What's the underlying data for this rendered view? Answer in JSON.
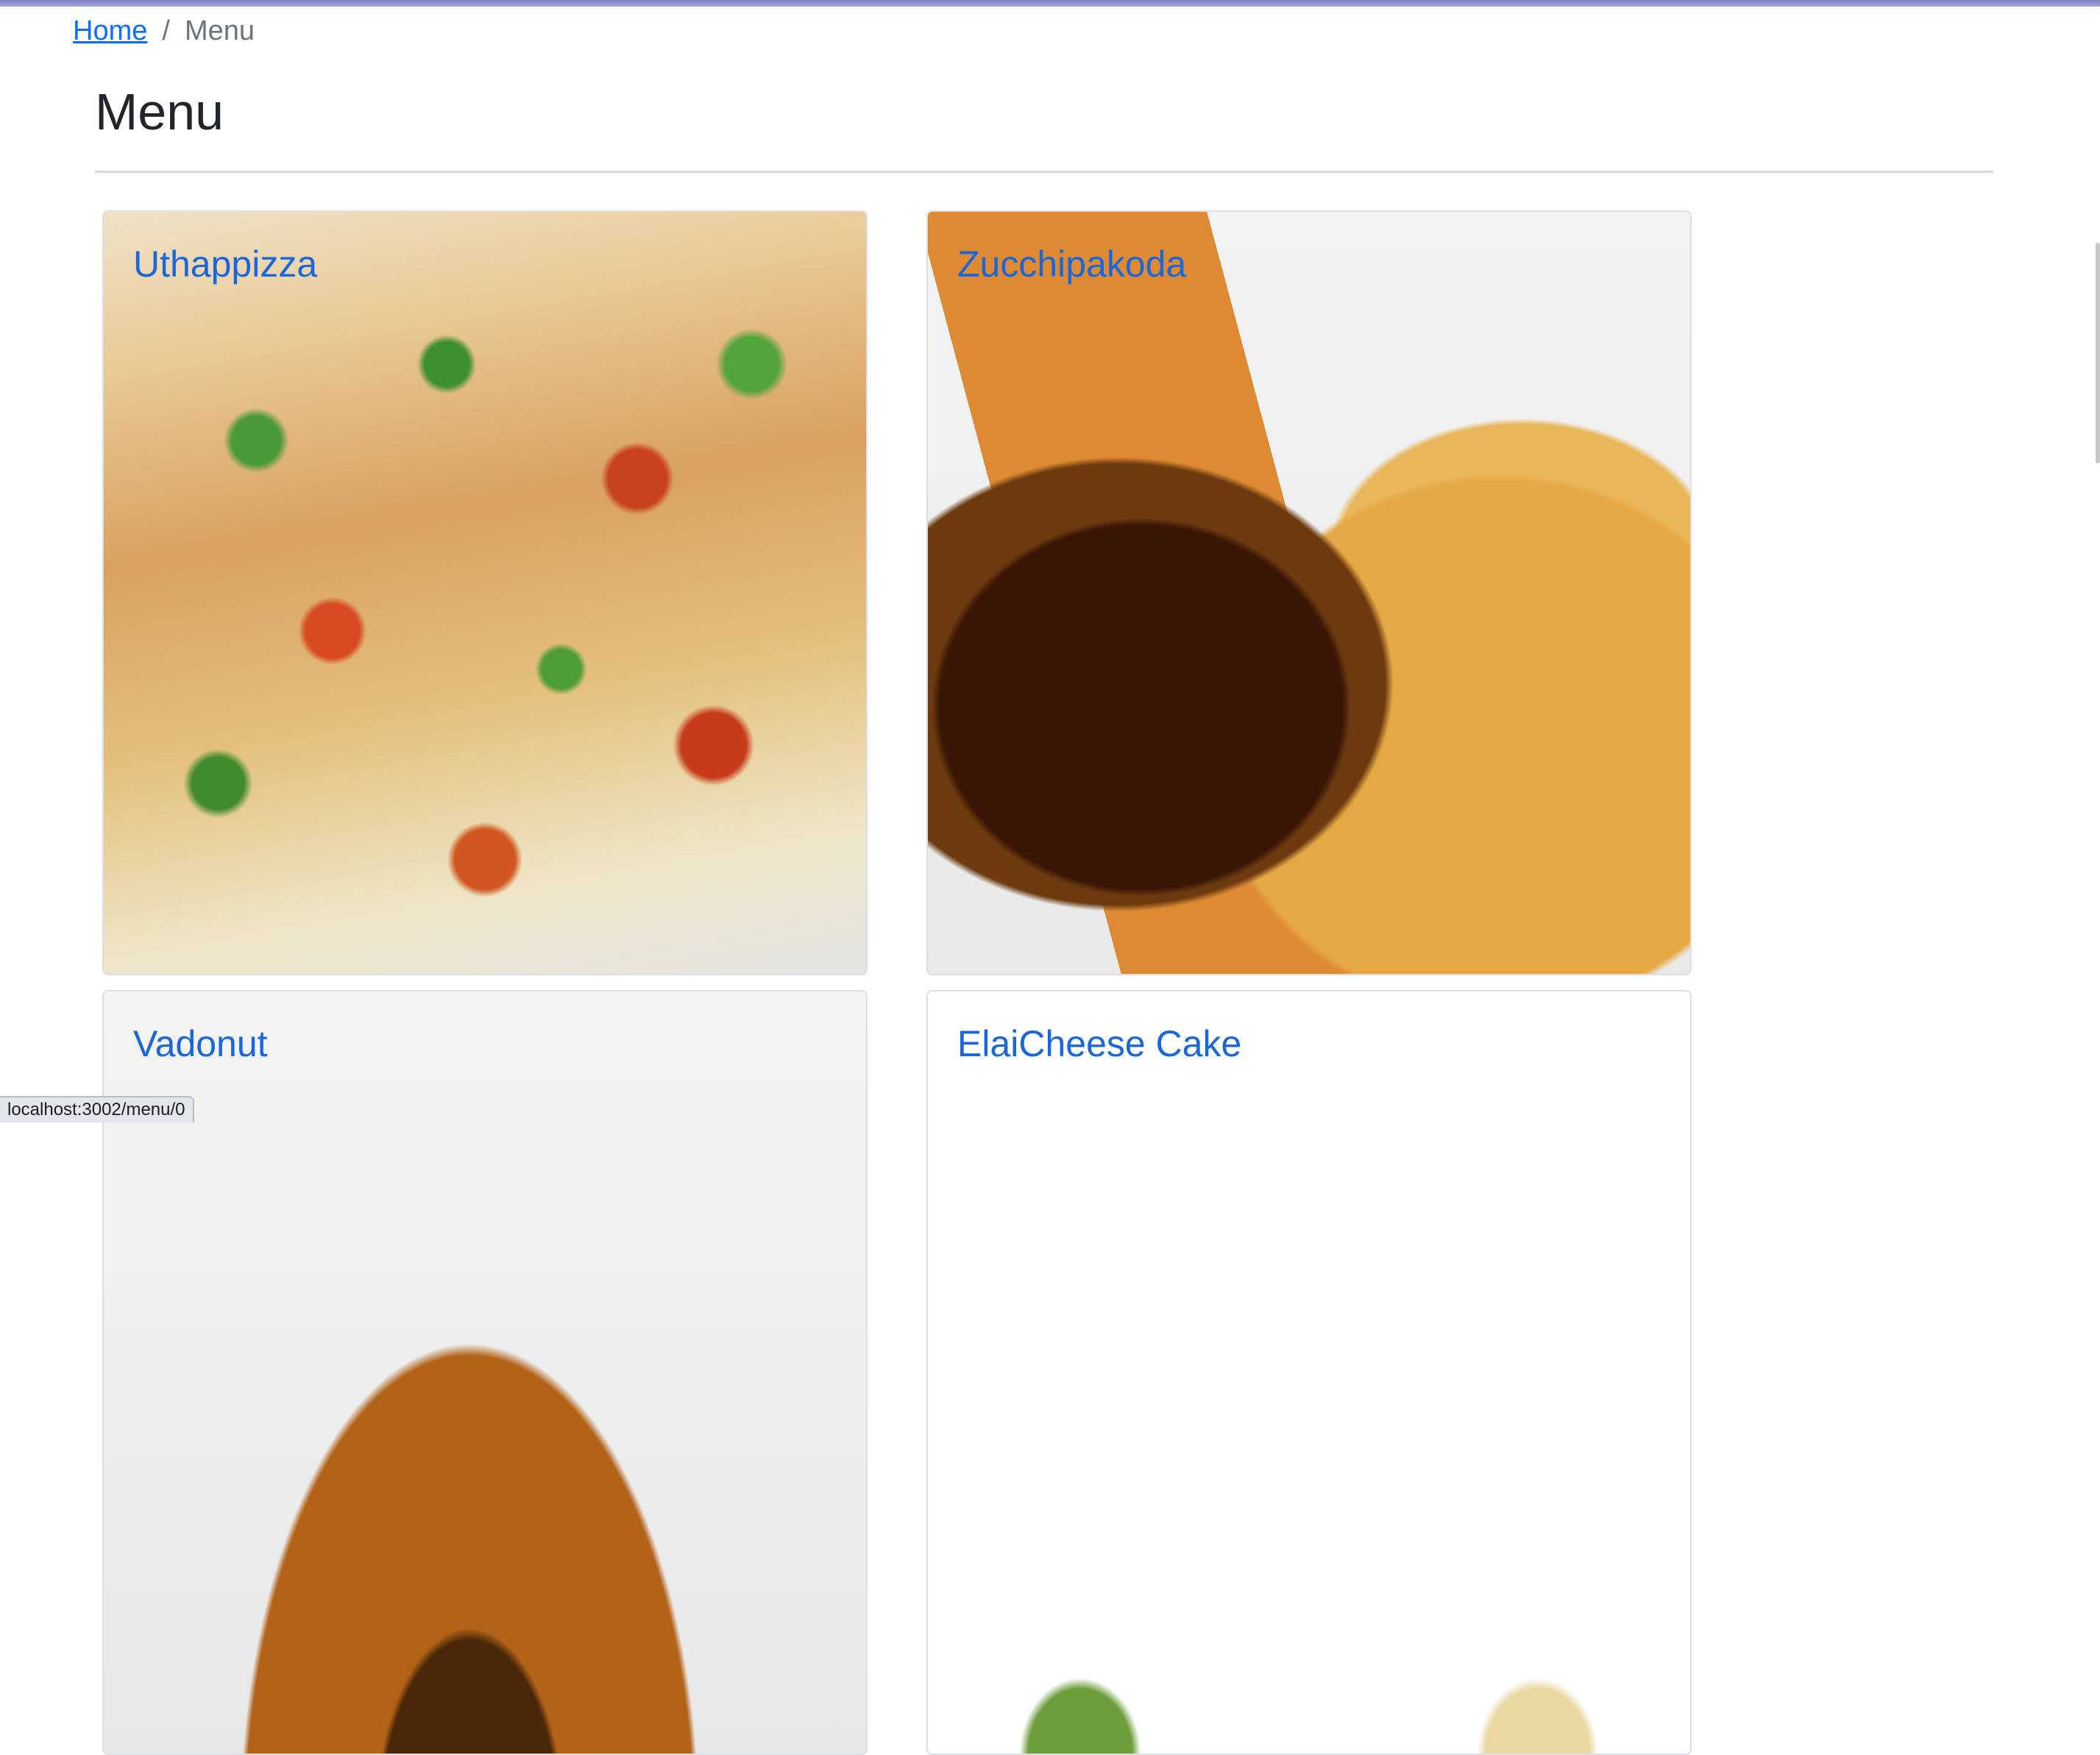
{
  "breadcrumb": {
    "home_label": "Home",
    "separator": "/",
    "current_label": "Menu"
  },
  "page": {
    "title": "Menu"
  },
  "menu_items": [
    {
      "name": "Uthappizza"
    },
    {
      "name": "Zucchipakoda"
    },
    {
      "name": "Vadonut"
    },
    {
      "name": "ElaiCheese Cake"
    }
  ],
  "status_bar": {
    "url": "localhost:3002/menu/0"
  },
  "colors": {
    "link": "#0d6efd",
    "card_title": "#1a66db",
    "heading": "#212529",
    "muted": "#6c757d"
  }
}
